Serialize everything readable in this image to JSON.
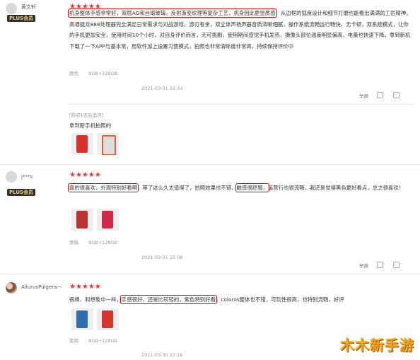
{
  "reviews": [
    {
      "user": "黄文轩",
      "badge": "PLUS会员",
      "stars": "★★★★★",
      "highlight": "机身整体手感非常好，双层AG和丝缎玻璃，反射渐变纹理等复杂工艺，机身因此更显质感",
      "rest": "，从边框的弧度设计和细节打磨也能看出满满的工匠精神。高通骁龙888处理器完全满足日常需求与对战游戏，游刃有余，双立体声扬声器音质清晰细腻，操作系统流畅运行畅快，无卡顿，双系统模式，让你的手机更加安全，使用时间10个小时，对自身评价而言，无可挑剔，使用期间感觉手机发热，摄像头部位温度明显偏高，电量也快速下降，拿到新机下载了一下APP与基本常，用软件加上设置习惯模式，拍照也非常清晰度非常高，持续保持评价中",
      "color": "颜色",
      "spec": "8GB+128GB",
      "date": "2021-03-31 22:34",
      "followup_tag": "[购买1天后追评]",
      "followup_text": "拿到新手机拍照的"
    },
    {
      "user": "j***s",
      "badge": "PLUS会员",
      "stars": "★★★★★",
      "hl1": "真的很喜欢，外观特别好看啊",
      "mid1": "，等了这么久太值得了，拍照效果也不错，",
      "hl2": "触感很舒服，",
      "tail": "运营行也很流畅，我还是觉得黑色更好看点，总之很喜欢！",
      "color": "原暗",
      "spec": "8GB+128GB",
      "date": "2021-03-31 15:08"
    },
    {
      "user": "AilurusPulgens~",
      "stars": "★★★★★",
      "pre": "很棒，和想象中一样，",
      "hl": "手感很好，还是比较轻的，紫色特别好看",
      "post": "，coloros整体也不错，可玩性很高，也特别流畅，好评",
      "color": "素网",
      "spec": "8GB+128GB",
      "date": "2021-03-30 22:16"
    }
  ],
  "actions": {
    "report": "举报"
  },
  "watermark": "木木新手游",
  "colors": {
    "star": "#e4393c",
    "highlight_box": "#d41111",
    "badge_bg": "#2f2f2f",
    "badge_text": "#f4d27a",
    "watermark": "#f2a21b"
  },
  "icons": [
    "avatar-icon",
    "like-icon",
    "comment-icon"
  ]
}
